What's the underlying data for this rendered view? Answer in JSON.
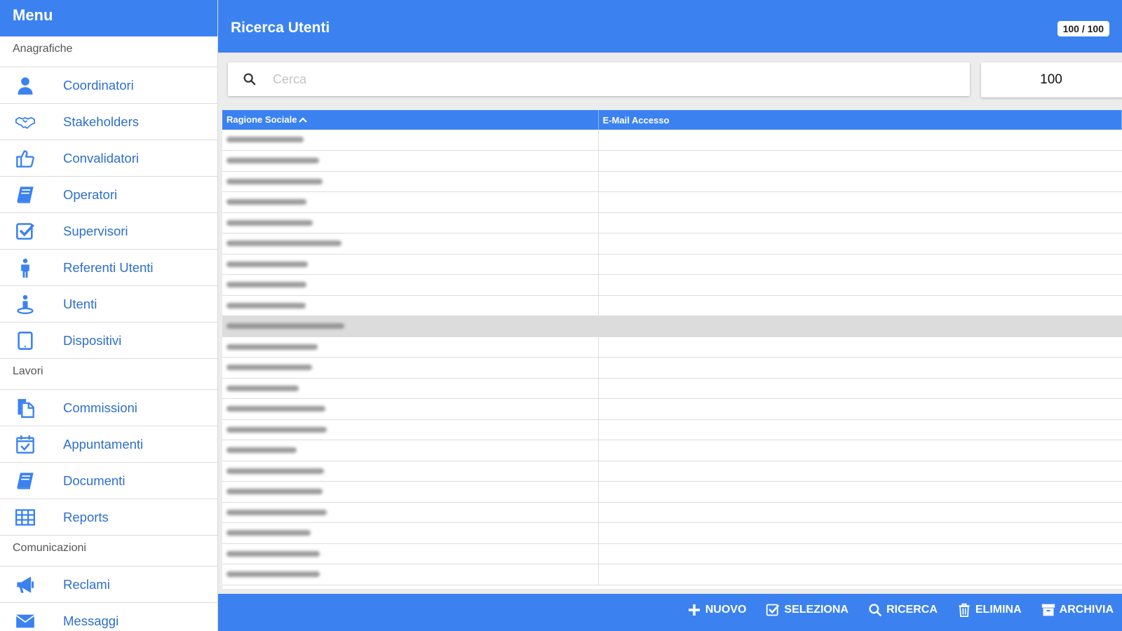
{
  "sidebar": {
    "title": "Menu",
    "sections": [
      {
        "title": "Anagrafiche",
        "items": [
          {
            "label": "Coordinatori",
            "icon": "user-icon"
          },
          {
            "label": "Stakeholders",
            "icon": "handshake-icon"
          },
          {
            "label": "Convalidatori",
            "icon": "thumbs-up-icon"
          },
          {
            "label": "Operatori",
            "icon": "book-icon"
          },
          {
            "label": "Supervisori",
            "icon": "check-square-icon"
          },
          {
            "label": "Referenti Utenti",
            "icon": "person-standing-icon"
          },
          {
            "label": "Utenti",
            "icon": "person-pedestal-icon"
          },
          {
            "label": "Dispositivi",
            "icon": "tablet-icon"
          }
        ]
      },
      {
        "title": "Lavori",
        "items": [
          {
            "label": "Commissioni",
            "icon": "files-icon"
          },
          {
            "label": "Appuntamenti",
            "icon": "calendar-check-icon"
          },
          {
            "label": "Documenti",
            "icon": "book-icon"
          },
          {
            "label": "Reports",
            "icon": "table-grid-icon"
          }
        ]
      },
      {
        "title": "Comunicazioni",
        "items": [
          {
            "label": "Reclami",
            "icon": "megaphone-icon"
          },
          {
            "label": "Messaggi",
            "icon": "envelope-icon"
          }
        ]
      }
    ]
  },
  "header": {
    "title": "Ricerca Utenti",
    "count": "100 / 100"
  },
  "search": {
    "placeholder": "Cerca",
    "value": "",
    "limit": "100"
  },
  "table": {
    "columns": [
      "Ragione Sociale",
      "E-Mail Accesso"
    ],
    "sort_column": "Ragione Sociale",
    "sort_direction": "ascending",
    "selected_row_index": 9
  },
  "actions": [
    {
      "label": "NUOVO",
      "icon": "plus-icon"
    },
    {
      "label": "SELEZIONA",
      "icon": "check-square-icon"
    },
    {
      "label": "RICERCA",
      "icon": "search-icon"
    },
    {
      "label": "ELIMINA",
      "icon": "trash-icon"
    },
    {
      "label": "ARCHIVIA",
      "icon": "archive-icon"
    }
  ],
  "colors": {
    "primary": "#3b82f0",
    "link": "#2d6fcc",
    "selected_row": "#dcdcdc"
  }
}
